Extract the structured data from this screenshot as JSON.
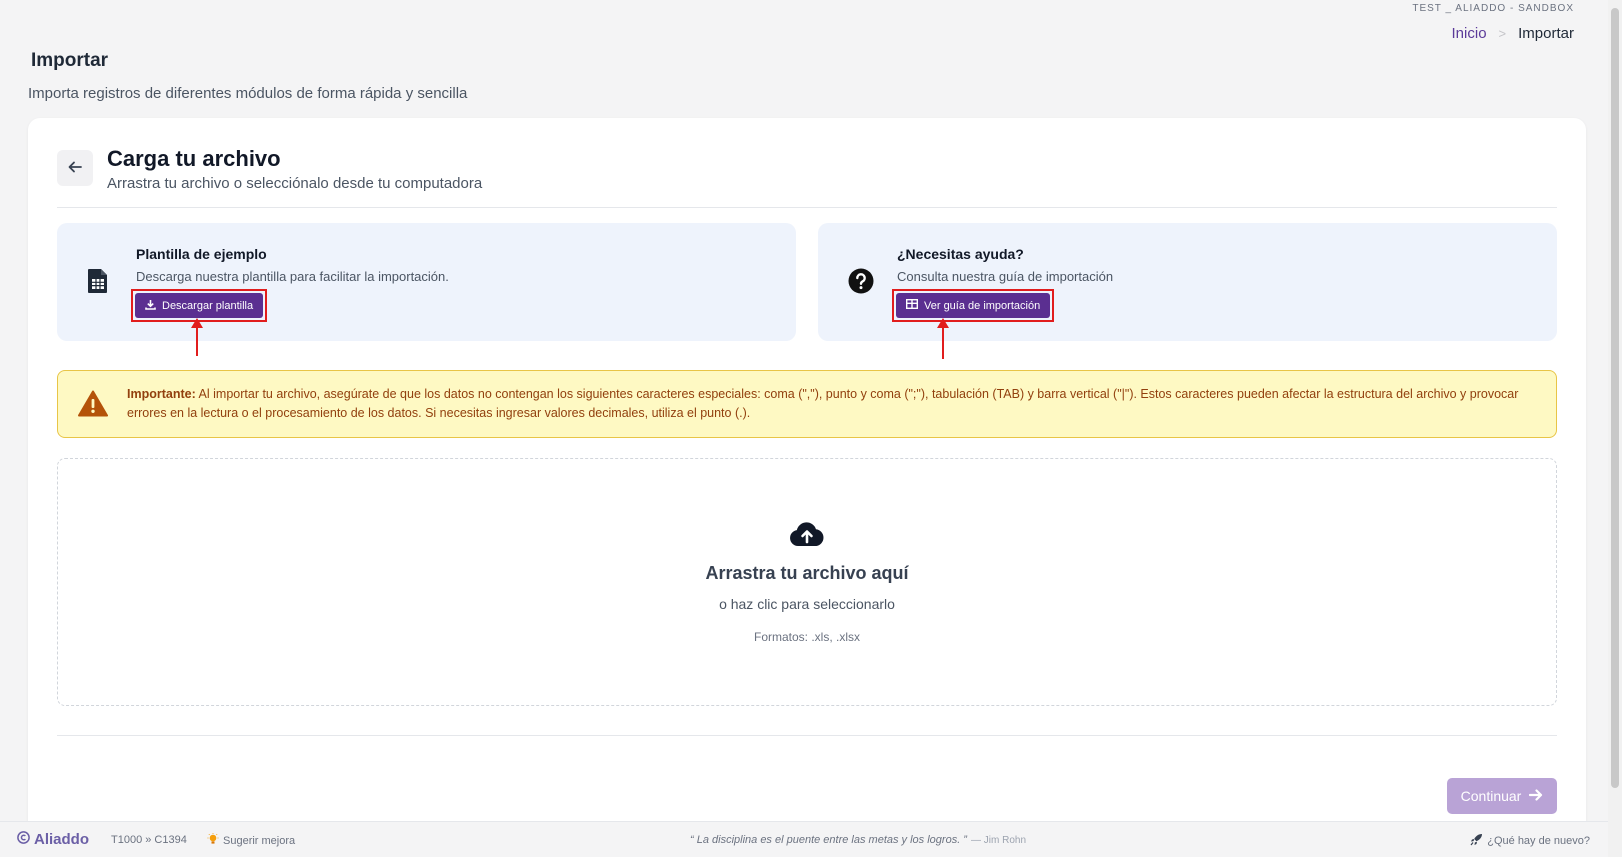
{
  "header": {
    "company": "TEST _ ALIADDO - SANDBOX",
    "breadcrumb": {
      "home": "Inicio",
      "separator": ">",
      "current": "Importar"
    },
    "title": "Importar",
    "subtitle": "Importa registros de diferentes módulos de forma rápida y sencilla"
  },
  "card": {
    "title": "Carga tu archivo",
    "subtitle": "Arrastra tu archivo o selecciónalo desde tu computadora"
  },
  "template_box": {
    "heading": "Plantilla de ejemplo",
    "text": "Descarga nuestra plantilla para facilitar la importación.",
    "button_label": "Descargar plantilla",
    "icon": "file-spreadsheet-icon"
  },
  "help_box": {
    "heading": "¿Necesitas ayuda?",
    "text": "Consulta nuestra guía de importación",
    "button_label": "Ver guía de importación",
    "icon": "question-circle-icon"
  },
  "warning": {
    "label": "Importante:",
    "text": "Al importar tu archivo, asegúrate de que los datos no contengan los siguientes caracteres especiales: coma (\",\"), punto y coma (\";\"), tabulación (TAB) y barra vertical (\"|\"). Estos caracteres pueden afectar la estructura del archivo y provocar errores en la lectura o el procesamiento de los datos. Si necesitas ingresar valores decimales, utiliza el punto (.)."
  },
  "dropzone": {
    "title": "Arrastra tu archivo aquí",
    "subtitle": "o haz clic para seleccionarlo",
    "formats": "Formatos: .xls, .xlsx"
  },
  "actions": {
    "continue_label": "Continuar"
  },
  "footer": {
    "brand": "Aliaddo",
    "code": "T1000 » C1394",
    "suggest": "Sugerir mejora",
    "quote": "“ La disciplina es el puente entre las metas y los logros. ”",
    "author": "— Jim Rohn",
    "whats_new": "¿Qué hay de nuevo?"
  },
  "colors": {
    "primary": "#5b2f91",
    "primary_disabled": "#b9a3d6",
    "info_bg": "#eef3fc",
    "warning_bg": "#fef9c3",
    "warning_text": "#92400e",
    "annotation_red": "#e11d1d"
  }
}
